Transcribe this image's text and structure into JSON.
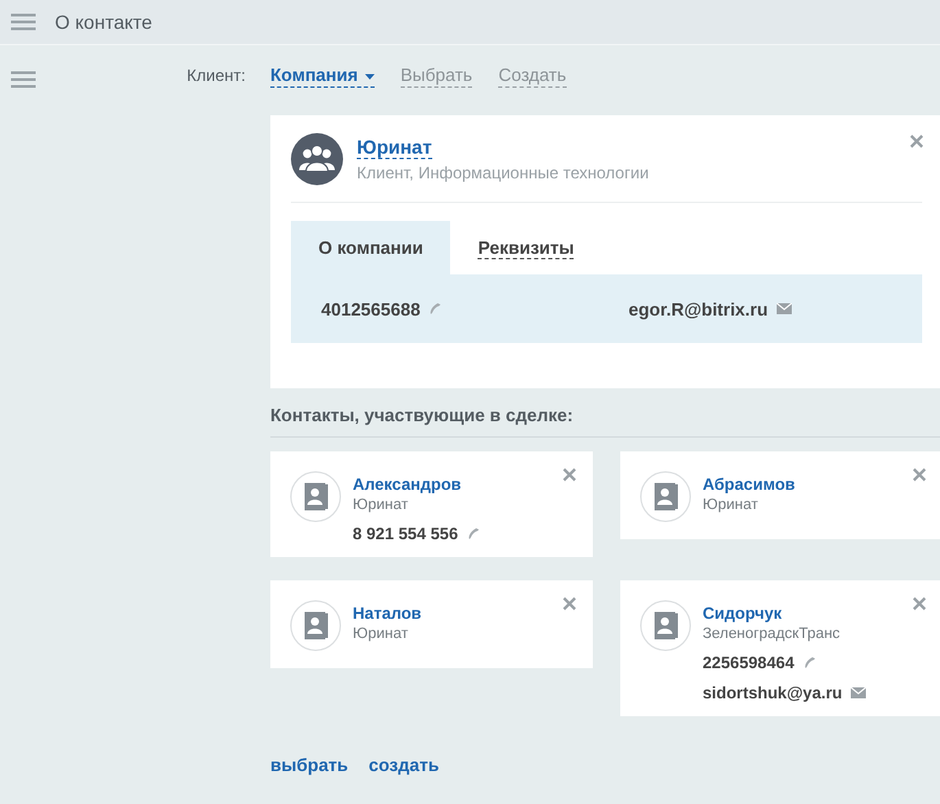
{
  "header": {
    "title": "О контакте"
  },
  "client": {
    "label": "Клиент:",
    "options": [
      {
        "label": "Компания",
        "selected": true
      },
      {
        "label": "Выбрать",
        "selected": false
      },
      {
        "label": "Создать",
        "selected": false
      }
    ]
  },
  "company": {
    "name": "Юринат",
    "subtitle": "Клиент, Информационные технологии",
    "tabs": [
      {
        "label": "О компании",
        "selected": true
      },
      {
        "label": "Реквизиты",
        "selected": false
      }
    ],
    "phone": "4012565688",
    "email": "egor.R@bitrix.ru"
  },
  "contacts_heading": "Контакты, участвующие в сделке:",
  "contacts": [
    {
      "name": "Александров",
      "company": "Юринат",
      "phone": "8 921 554 556"
    },
    {
      "name": "Абрасимов",
      "company": "Юринат"
    },
    {
      "name": "Наталов",
      "company": "Юринат"
    },
    {
      "name": "Сидорчук",
      "company": "ЗеленоградскТранс",
      "phone": "2256598464",
      "email": "sidortshuk@ya.ru"
    }
  ],
  "footer_links": [
    "выбрать",
    "создать"
  ]
}
